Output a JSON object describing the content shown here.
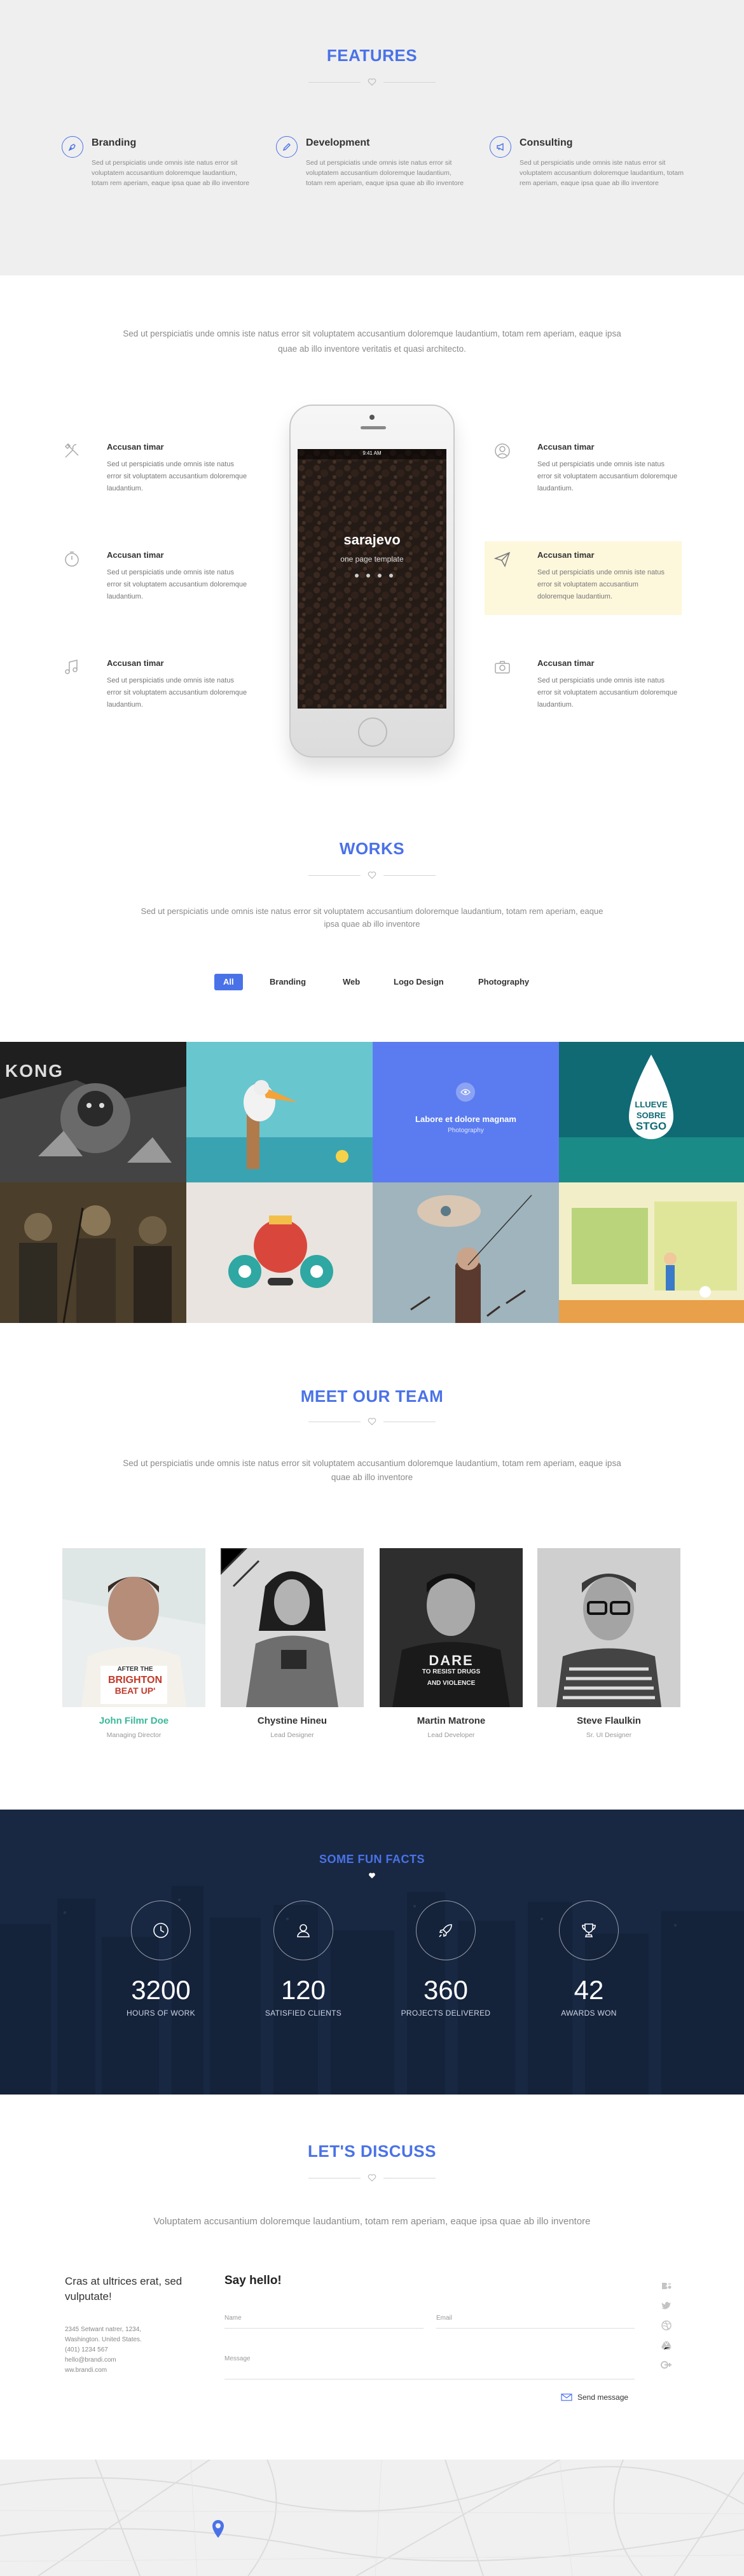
{
  "features": {
    "title": "FEATURES",
    "items": [
      {
        "title": "Branding",
        "text": "Sed ut perspiciatis unde omnis iste natus error sit voluptatem accusantium doloremque laudantium, totam rem aperiam, eaque ipsa quae ab illo inventore",
        "icon": "pen-nib-icon"
      },
      {
        "title": "Development",
        "text": "Sed ut perspiciatis unde omnis iste natus error sit voluptatem accusantium doloremque laudantium, totam rem aperiam, eaque ipsa quae ab illo inventore",
        "icon": "pencil-icon"
      },
      {
        "title": "Consulting",
        "text": "Sed ut perspiciatis unde omnis iste natus error sit voluptatem accusantium doloremque laudantium, totam rem aperiam, eaque ipsa quae ab illo inventore",
        "icon": "megaphone-icon"
      }
    ]
  },
  "app": {
    "lead": "Sed ut perspiciatis unde omnis iste natus error sit voluptatem accusantium doloremque laudantium, totam rem aperiam, eaque ipsa quae ab illo inventore veritatis et quasi architecto.",
    "left": [
      {
        "title": "Accusan timar",
        "text": "Sed ut perspiciatis unde omnis iste natus error sit voluptatem accusantium doloremque laudantium.",
        "icon": "tools-icon"
      },
      {
        "title": "Accusan timar",
        "text": "Sed ut perspiciatis unde omnis iste natus error sit voluptatem accusantium doloremque laudantium.",
        "icon": "timer-icon"
      },
      {
        "title": "Accusan timar",
        "text": "Sed ut perspiciatis unde omnis iste natus error sit voluptatem accusantium doloremque laudantium.",
        "icon": "music-note-icon"
      }
    ],
    "right": [
      {
        "title": "Accusan timar",
        "text": "Sed ut perspiciatis unde omnis iste natus error sit voluptatem accusantium doloremque laudantium.",
        "icon": "user-icon"
      },
      {
        "title": "Accusan timar",
        "text": "Sed ut perspiciatis unde omnis iste natus error sit voluptatem accusantium doloremque laudantium.",
        "icon": "paper-plane-icon"
      },
      {
        "title": "Accusan timar",
        "text": "Sed ut perspiciatis unde omnis iste natus error sit voluptatem accusantium doloremque laudantium.",
        "icon": "camera-icon"
      }
    ],
    "phone": {
      "status_time": "9:41 AM",
      "app_name": "sarajevo",
      "tagline": "one page template"
    }
  },
  "works": {
    "title": "WORKS",
    "lead": "Sed ut perspiciatis unde omnis iste natus error sit voluptatem accusantium doloremque laudantium, totam rem aperiam, eaque ipsa quae ab illo inventore",
    "filters": [
      "All",
      "Branding",
      "Web",
      "Logo Design",
      "Photography"
    ],
    "active_filter": "All",
    "hover_title": "Labore et dolore magnam",
    "hover_category": "Photography",
    "poster_text": [
      "LLUEVE",
      "SOBRE",
      "STGO"
    ],
    "kong_text": "KONG"
  },
  "team": {
    "title": "MEET OUR TEAM",
    "lead": "Sed ut perspiciatis unde omnis iste natus error sit voluptatem accusantium doloremque laudantium, totam rem aperiam, eaque ipsa quae ab illo inventore",
    "members": [
      {
        "name": "John Filmr Doe",
        "role": "Managing Director",
        "shirt": [
          "AFTER THE",
          "BRIGHTON",
          "BEAT UP'"
        ]
      },
      {
        "name": "Chystine Hineu",
        "role": "Lead Designer"
      },
      {
        "name": "Martin Matrone",
        "role": "Lead Developer",
        "shirt": [
          "DARE",
          "TO RESIST DRUGS",
          "AND VIOLENCE"
        ]
      },
      {
        "name": "Steve Flaulkin",
        "role": "Sr. UI Designer"
      }
    ],
    "highlight_color": "#3ab89a"
  },
  "facts": {
    "title": "SOME FUN FACTS",
    "items": [
      {
        "value": "3200",
        "label": "HOURS OF WORK",
        "icon": "clock-icon"
      },
      {
        "value": "120",
        "label": "SATISFIED CLIENTS",
        "icon": "user-icon"
      },
      {
        "value": "360",
        "label": "PROJECTS DELIVERED",
        "icon": "rocket-icon"
      },
      {
        "value": "42",
        "label": "AWARDS WON",
        "icon": "trophy-icon"
      }
    ]
  },
  "discuss": {
    "title": "LET'S DISCUSS",
    "lead": "Voluptatem accusantium doloremque laudantium, totam rem aperiam, eaque ipsa quae ab illo inventore",
    "contact_heading": "Cras at ultrices erat, sed vulputate!",
    "address": [
      "2345 Setwant natrer, 1234,",
      "Washington. United States.",
      "(401) 1234 567",
      "hello@brandi.com",
      "ww.brandi.com"
    ],
    "form_heading": "Say hello!",
    "name_placeholder": "Name",
    "email_placeholder": "Email",
    "message_placeholder": "Message",
    "send_label": "Send message",
    "social": [
      "behance-icon",
      "twitter-icon",
      "dribbble-icon",
      "google-drive-icon",
      "google-plus-icon"
    ]
  },
  "colors": {
    "accent": "#4a72e8",
    "facts_bg": "#1b2b45",
    "feature_bg": "#efefef",
    "highlight_bg": "#fdf7dc"
  }
}
